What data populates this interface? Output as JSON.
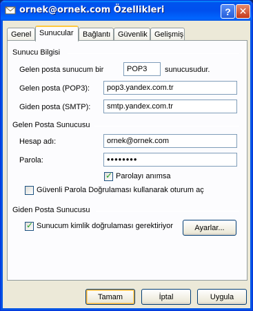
{
  "window": {
    "title": "ornek@ornek.com Özellikleri",
    "help_label": "?",
    "close_label": "✕"
  },
  "tabs": [
    {
      "label": "Genel"
    },
    {
      "label": "Sunucular",
      "active": true
    },
    {
      "label": "Bağlantı"
    },
    {
      "label": "Güvenlik"
    },
    {
      "label": "Gelişmiş"
    }
  ],
  "server_info": {
    "group_title": "Sunucu Bilgisi",
    "incoming_type_prefix": "Gelen posta sunucum bir",
    "incoming_type_value": "POP3",
    "incoming_type_suffix": "sunucusudur.",
    "incoming_label": "Gelen posta (POP3):",
    "incoming_value": "pop3.yandex.com.tr",
    "outgoing_label": "Giden posta (SMTP):",
    "outgoing_value": "smtp.yandex.com.tr"
  },
  "incoming_server": {
    "group_title": "Gelen Posta Sunucusu",
    "account_label": "Hesap adı:",
    "account_value": "ornek@ornek.com",
    "password_label": "Parola:",
    "password_value": "••••••••",
    "remember_label": "Parolayı anımsa",
    "remember_checked": true,
    "spa_label": "Güvenli Parola Doğrulaması kullanarak oturum aç",
    "spa_checked": false
  },
  "outgoing_server": {
    "group_title": "Giden Posta Sunucusu",
    "auth_label": "Sunucum kimlik doğrulaması gerektiriyor",
    "auth_checked": true,
    "settings_label": "Ayarlar..."
  },
  "buttons": {
    "ok": "Tamam",
    "cancel": "İptal",
    "apply": "Uygula"
  },
  "colors": {
    "titlebar": "#0053ee",
    "dialog_bg": "#ece9d8",
    "panel_bg": "#fcfcfe",
    "tab_highlight": "#ffc83c",
    "check_green": "#21a121"
  },
  "icons": {
    "window_icon": "envelope-icon",
    "help": "help-icon",
    "close": "close-icon",
    "check": "checkmark-icon"
  }
}
